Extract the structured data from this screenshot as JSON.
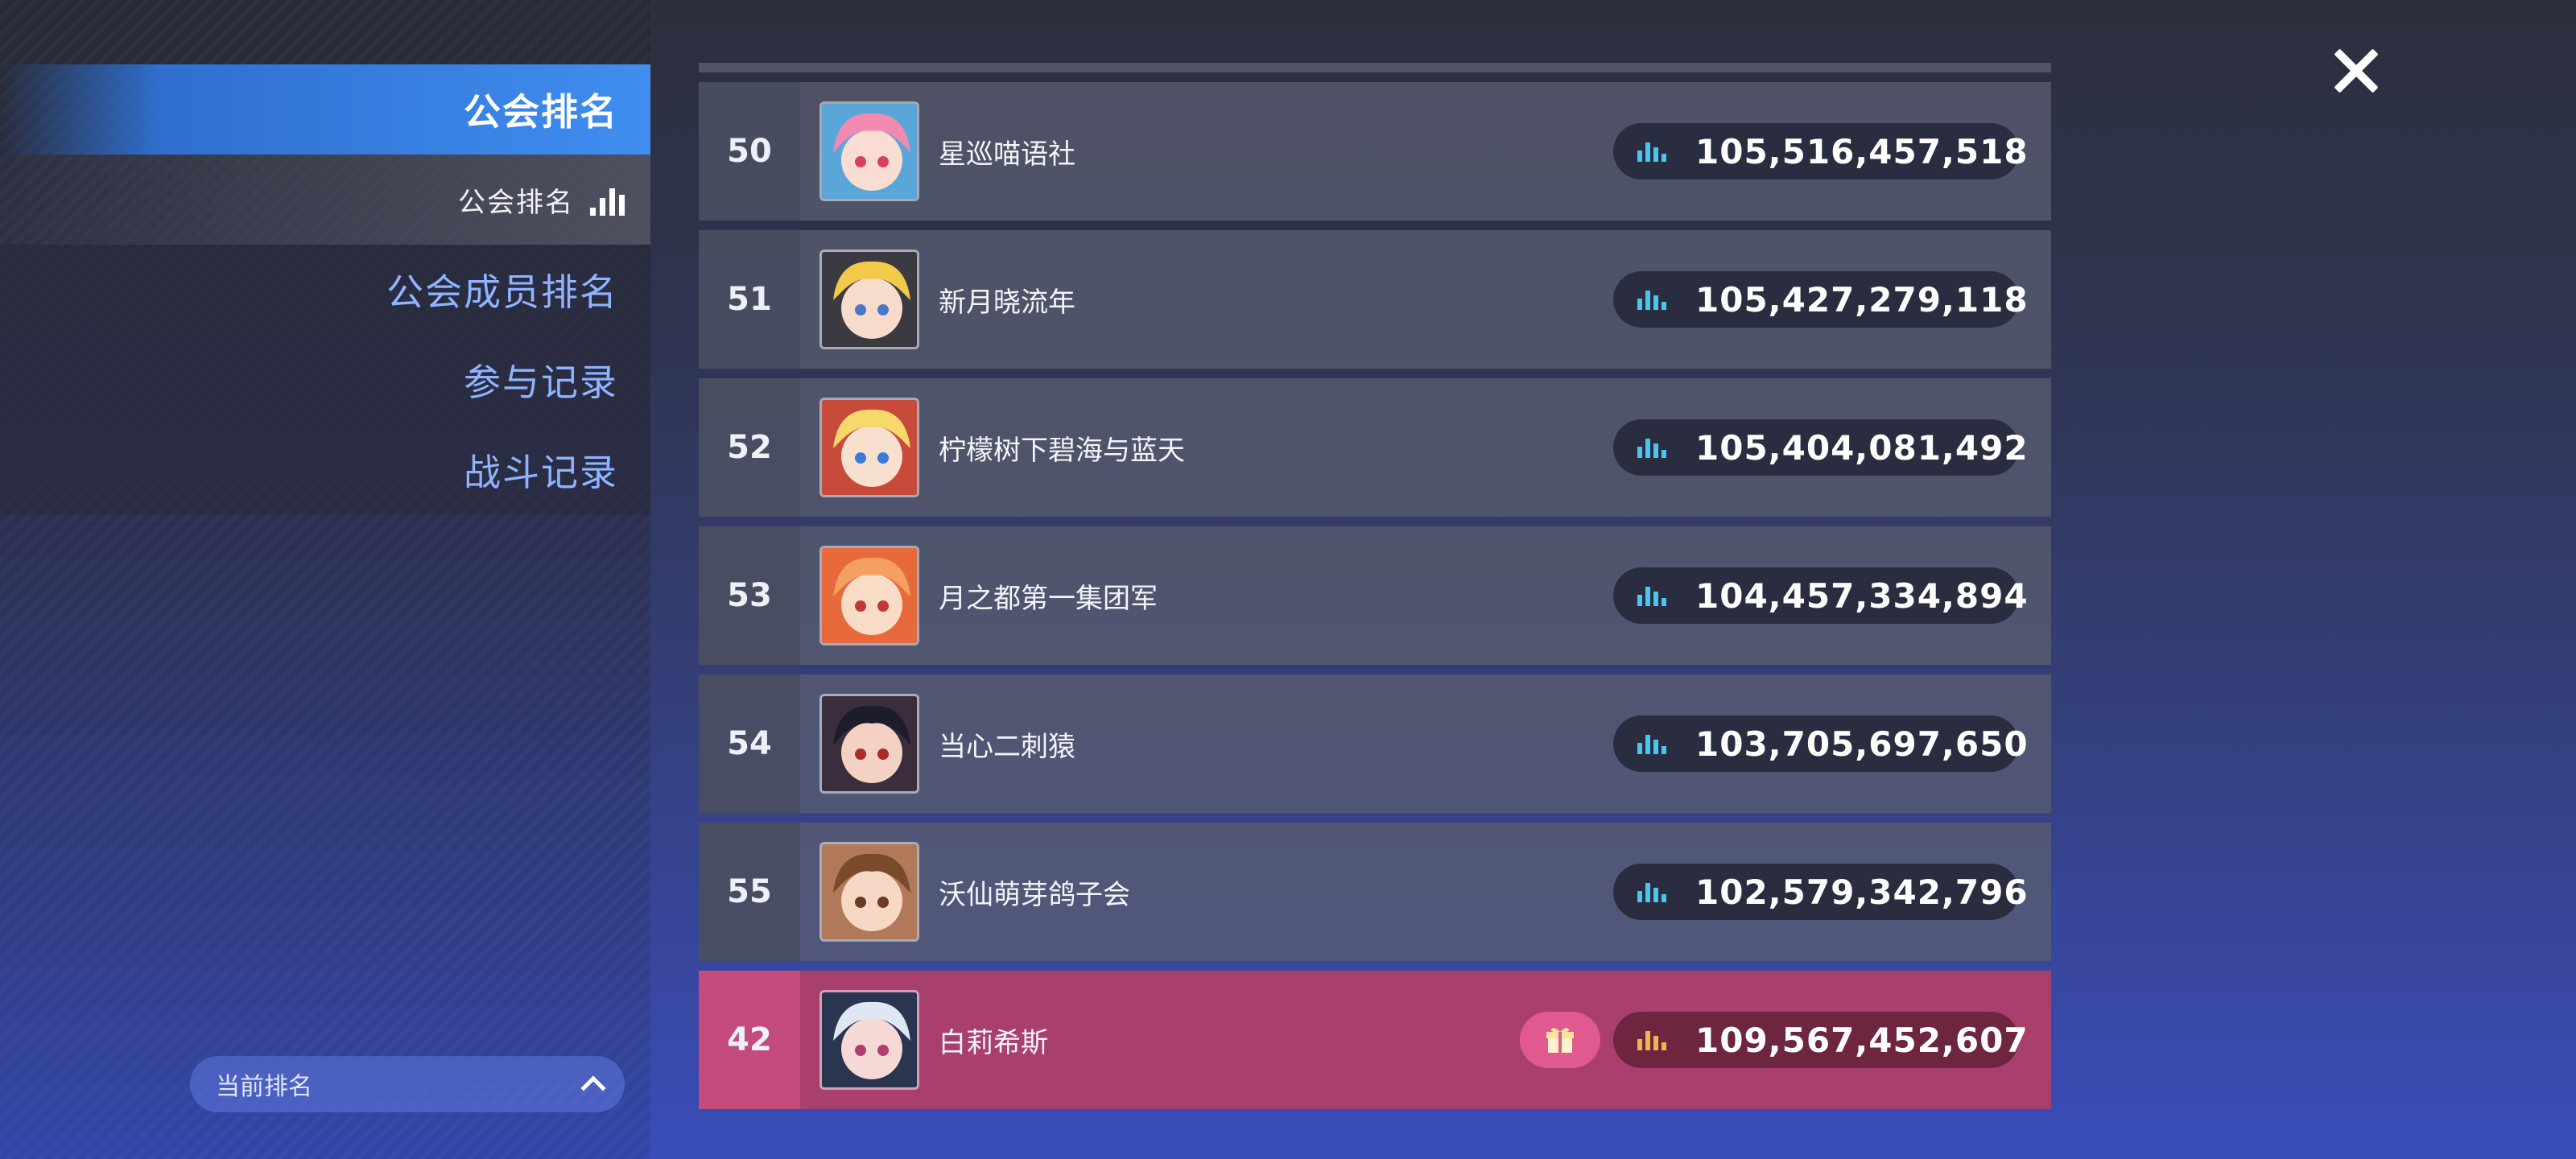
{
  "sidebar": {
    "active_tab": "公会排名",
    "sub_tab": "公会排名",
    "items": [
      {
        "label": "公会成员排名"
      },
      {
        "label": "参与记录"
      },
      {
        "label": "战斗记录"
      }
    ],
    "current_rank_label": "当前排名"
  },
  "rows": [
    {
      "rank": "50",
      "name": "星巡喵语社",
      "score": "105,516,457,518",
      "avatar_icon": "guild-avatar-pink-hair"
    },
    {
      "rank": "51",
      "name": "新月晓流年",
      "score": "105,427,279,118",
      "avatar_icon": "guild-avatar-blonde"
    },
    {
      "rank": "52",
      "name": "柠檬树下碧海与蓝天",
      "score": "105,404,081,492",
      "avatar_icon": "guild-avatar-yellow-hair"
    },
    {
      "rank": "53",
      "name": "月之都第一集团军",
      "score": "104,457,334,894",
      "avatar_icon": "guild-avatar-orange-hair"
    },
    {
      "rank": "54",
      "name": "当心二刺猿",
      "score": "103,705,697,650",
      "avatar_icon": "guild-avatar-dark-hair"
    },
    {
      "rank": "55",
      "name": "沃仙萌芽鸽子会",
      "score": "102,579,342,796",
      "avatar_icon": "guild-avatar-brown-hair"
    }
  ],
  "my_guild": {
    "rank": "42",
    "name": "白莉希斯",
    "score": "109,567,452,607",
    "avatar_icon": "guild-avatar-white-hair"
  },
  "colors": {
    "accent": "#3f8ef0",
    "score_icon": "#4bc4ee",
    "highlight_row": "#a83f6d",
    "highlight_icon": "#f3b24e"
  }
}
